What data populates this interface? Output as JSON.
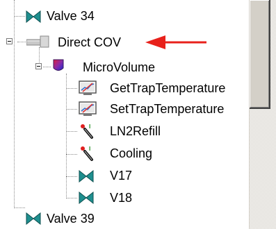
{
  "tree": {
    "nodes": [
      {
        "label": "Valve 34",
        "icon": "valve-icon"
      },
      {
        "label": "Direct COV",
        "icon": "pipe-icon",
        "expanded": true
      },
      {
        "label": "MicroVolume",
        "icon": "microvolume-icon",
        "expanded": true
      },
      {
        "label": "GetTrapTemperature",
        "icon": "trap-temperature-icon"
      },
      {
        "label": "SetTrapTemperature",
        "icon": "trap-temperature-icon"
      },
      {
        "label": "LN2Refill",
        "icon": "ln2-refill-icon"
      },
      {
        "label": "Cooling",
        "icon": "cooling-icon"
      },
      {
        "label": "V17",
        "icon": "valve-icon"
      },
      {
        "label": "V18",
        "icon": "valve-icon"
      },
      {
        "label": "Valve 39",
        "icon": "valve-icon"
      }
    ]
  },
  "annotation": {
    "arrow_color": "#e8211b",
    "points_to": "Direct COV"
  },
  "colors": {
    "valve": "#1f8f8f",
    "scrollbar_face": "#d4d0c8"
  }
}
